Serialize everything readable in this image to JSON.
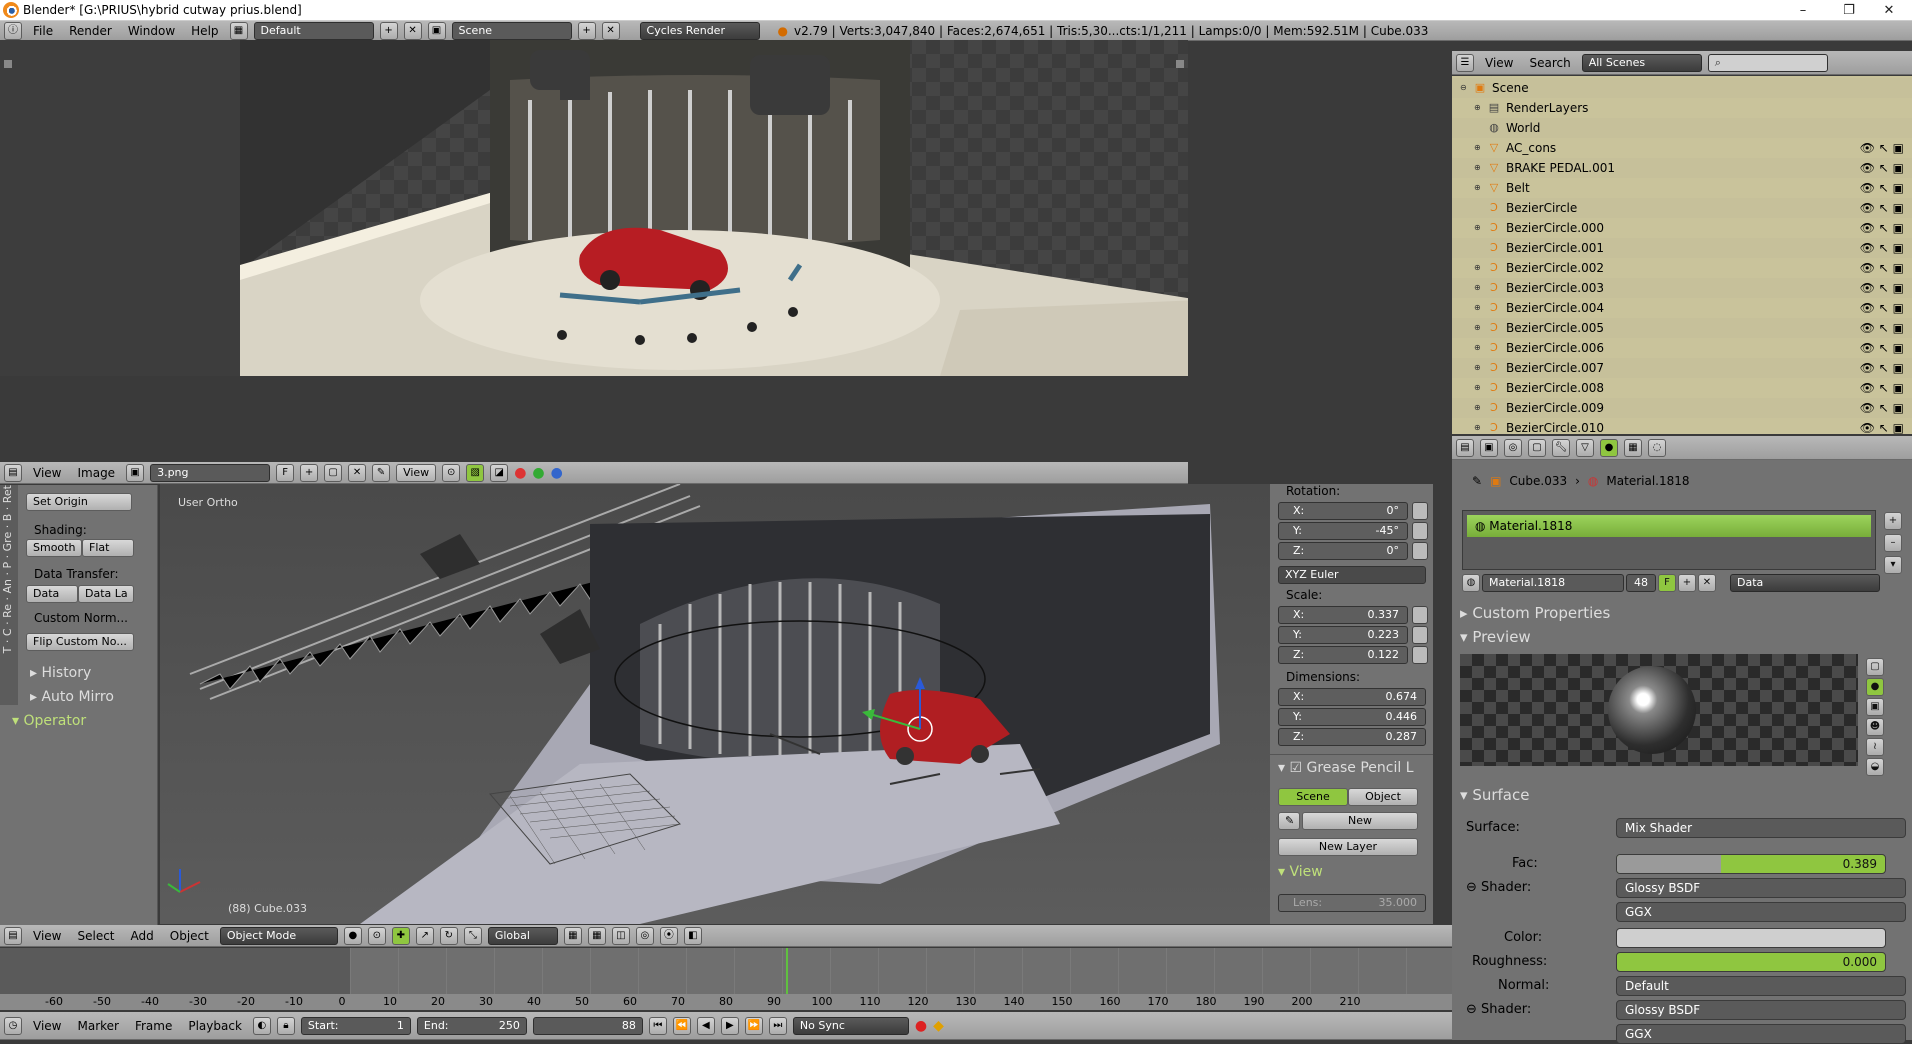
{
  "window": {
    "title": "Blender* [G:\\PRIUS\\hybrid cutway prius.blend]",
    "controls": [
      "–",
      "❐",
      "✕"
    ]
  },
  "info_header": {
    "menus": [
      "File",
      "Render",
      "Window",
      "Help"
    ],
    "layout": "Default",
    "scene": "Scene",
    "engine": "Cycles Render",
    "stats": "v2.79 | Verts:3,047,840 | Faces:2,674,651 | Tris:5,30...cts:1/1,211 | Lamps:0/0 | Mem:592.51M | Cube.033"
  },
  "image_editor": {
    "menus": [
      "View",
      "Image"
    ],
    "image_name": "3.png",
    "fake_user": "F",
    "view_label": "View"
  },
  "viewport": {
    "label": "User Ortho",
    "object_info": "(88) Cube.033",
    "menus": [
      "View",
      "Select",
      "Add",
      "Object"
    ],
    "mode": "Object Mode",
    "orientation": "Global"
  },
  "tool_shelf": {
    "tabs": [
      "T",
      "C",
      "Re",
      "An",
      "P",
      "Gre",
      "B",
      "Ret"
    ],
    "set_origin": "Set Origin",
    "shading_label": "Shading:",
    "smooth": "Smooth",
    "flat": "Flat",
    "data_transfer_label": "Data Transfer:",
    "data": "Data",
    "data_layout": "Data La",
    "custom_normals": "Custom Norm...",
    "flip_custom": "Flip Custom No...",
    "history": "History",
    "auto_mirror": "Auto Mirro",
    "operator": "Operator"
  },
  "n_panel": {
    "rotation_label": "Rotation:",
    "rotation": [
      {
        "axis": "X:",
        "value": "0°"
      },
      {
        "axis": "Y:",
        "value": "-45°"
      },
      {
        "axis": "Z:",
        "value": "0°"
      }
    ],
    "euler": "XYZ Euler",
    "scale_label": "Scale:",
    "scale": [
      {
        "axis": "X:",
        "value": "0.337"
      },
      {
        "axis": "Y:",
        "value": "0.223"
      },
      {
        "axis": "Z:",
        "value": "0.122"
      }
    ],
    "dimensions_label": "Dimensions:",
    "dimensions": [
      {
        "axis": "X:",
        "value": "0.674"
      },
      {
        "axis": "Y:",
        "value": "0.446"
      },
      {
        "axis": "Z:",
        "value": "0.287"
      }
    ],
    "grease_pencil": "Grease Pencil L",
    "scene_tab": "Scene",
    "object_tab": "Object",
    "new": "New",
    "new_layer": "New Layer",
    "view": "View",
    "lens_label": "Lens:",
    "lens_value": "35.000"
  },
  "outliner": {
    "menus": [
      "View",
      "Search"
    ],
    "filter": "All Scenes",
    "items": [
      {
        "name": "Scene",
        "icon": "scene-icon"
      },
      {
        "name": "RenderLayers",
        "icon": "render-layers-icon"
      },
      {
        "name": "World",
        "icon": "world-icon"
      },
      {
        "name": "AC_cons",
        "icon": "mesh-icon"
      },
      {
        "name": "BRAKE PEDAL.001",
        "icon": "mesh-icon"
      },
      {
        "name": "Belt",
        "icon": "mesh-icon"
      },
      {
        "name": "BezierCircle",
        "icon": "curve-icon"
      },
      {
        "name": "BezierCircle.000",
        "icon": "curve-icon"
      },
      {
        "name": "BezierCircle.001",
        "icon": "curve-icon"
      },
      {
        "name": "BezierCircle.002",
        "icon": "curve-icon"
      },
      {
        "name": "BezierCircle.003",
        "icon": "curve-icon"
      },
      {
        "name": "BezierCircle.004",
        "icon": "curve-icon"
      },
      {
        "name": "BezierCircle.005",
        "icon": "curve-icon"
      },
      {
        "name": "BezierCircle.006",
        "icon": "curve-icon"
      },
      {
        "name": "BezierCircle.007",
        "icon": "curve-icon"
      },
      {
        "name": "BezierCircle.008",
        "icon": "curve-icon"
      },
      {
        "name": "BezierCircle.009",
        "icon": "curve-icon"
      },
      {
        "name": "BezierCircle.010",
        "icon": "curve-icon"
      }
    ]
  },
  "properties": {
    "breadcrumb_object": "Cube.033",
    "breadcrumb_material": "Material.1818",
    "slot": "Material.1818",
    "material_name": "Material.1818",
    "users": "48",
    "fake_user": "F",
    "link": "Data",
    "custom_properties": "Custom Properties",
    "preview": "Preview",
    "surface_section": "Surface",
    "surface_label": "Surface:",
    "surface_value": "Mix Shader",
    "fac_label": "Fac:",
    "fac_value": "0.389",
    "fac_fraction": 0.389,
    "shader_label": "Shader:",
    "shader1": "Glossy BSDF",
    "distribution": "GGX",
    "color_label": "Color:",
    "roughness_label": "Roughness:",
    "roughness_value": "0.000",
    "normal_label": "Normal:",
    "normal_value": "Default",
    "shader2_label": "Shader:",
    "shader2": "Glossy BSDF",
    "distribution2": "GGX"
  },
  "timeline": {
    "ruler": [
      "-60",
      "-50",
      "-40",
      "-30",
      "-20",
      "-10",
      "0",
      "10",
      "20",
      "30",
      "40",
      "50",
      "60",
      "70",
      "80",
      "90",
      "100",
      "110",
      "120",
      "130",
      "140",
      "150",
      "160",
      "170",
      "180",
      "190",
      "200",
      "210"
    ],
    "menus": [
      "View",
      "Marker",
      "Frame",
      "Playback"
    ],
    "start_label": "Start:",
    "start": "1",
    "end_label": "End:",
    "end": "250",
    "current": "88",
    "sync": "No Sync"
  },
  "colors": {
    "accent_green": "#8fc640",
    "outliner_bg": "#c9c39b",
    "panel_gray": "#727272"
  }
}
